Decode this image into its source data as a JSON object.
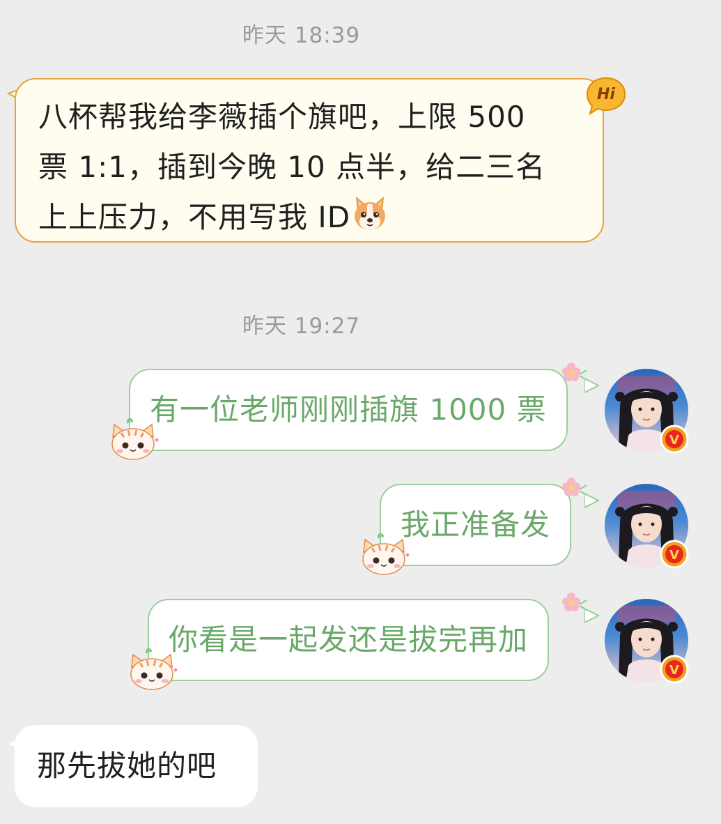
{
  "chat": {
    "timestamp_1": "昨天 18:39",
    "timestamp_2": "昨天 19:27",
    "messages": [
      {
        "direction": "received",
        "style": "special",
        "lines": [
          "八杯帮我给李薇插个旗吧，上限 500",
          "票 1:1，插到今晚 10 点半，给二三名",
          "上上压力，不用写我 ID"
        ],
        "emoji": "dog-emoji",
        "badge": "Hi"
      },
      {
        "direction": "sent",
        "text": "有一位老师刚刚插旗 1000 票"
      },
      {
        "direction": "sent",
        "text": "我正准备发"
      },
      {
        "direction": "sent",
        "text": "你看是一起发还是拔完再加"
      },
      {
        "direction": "received",
        "style": "plain",
        "text": "那先拔她的吧"
      }
    ]
  },
  "avatar": {
    "badge": "V"
  },
  "colors": {
    "background": "#ededed",
    "special_border": "#e9a13b",
    "special_fill": "#fffdf0",
    "sent_border": "#9bcf9b",
    "sent_text": "#6aa86a",
    "badge_orange": "#f0a01a"
  }
}
